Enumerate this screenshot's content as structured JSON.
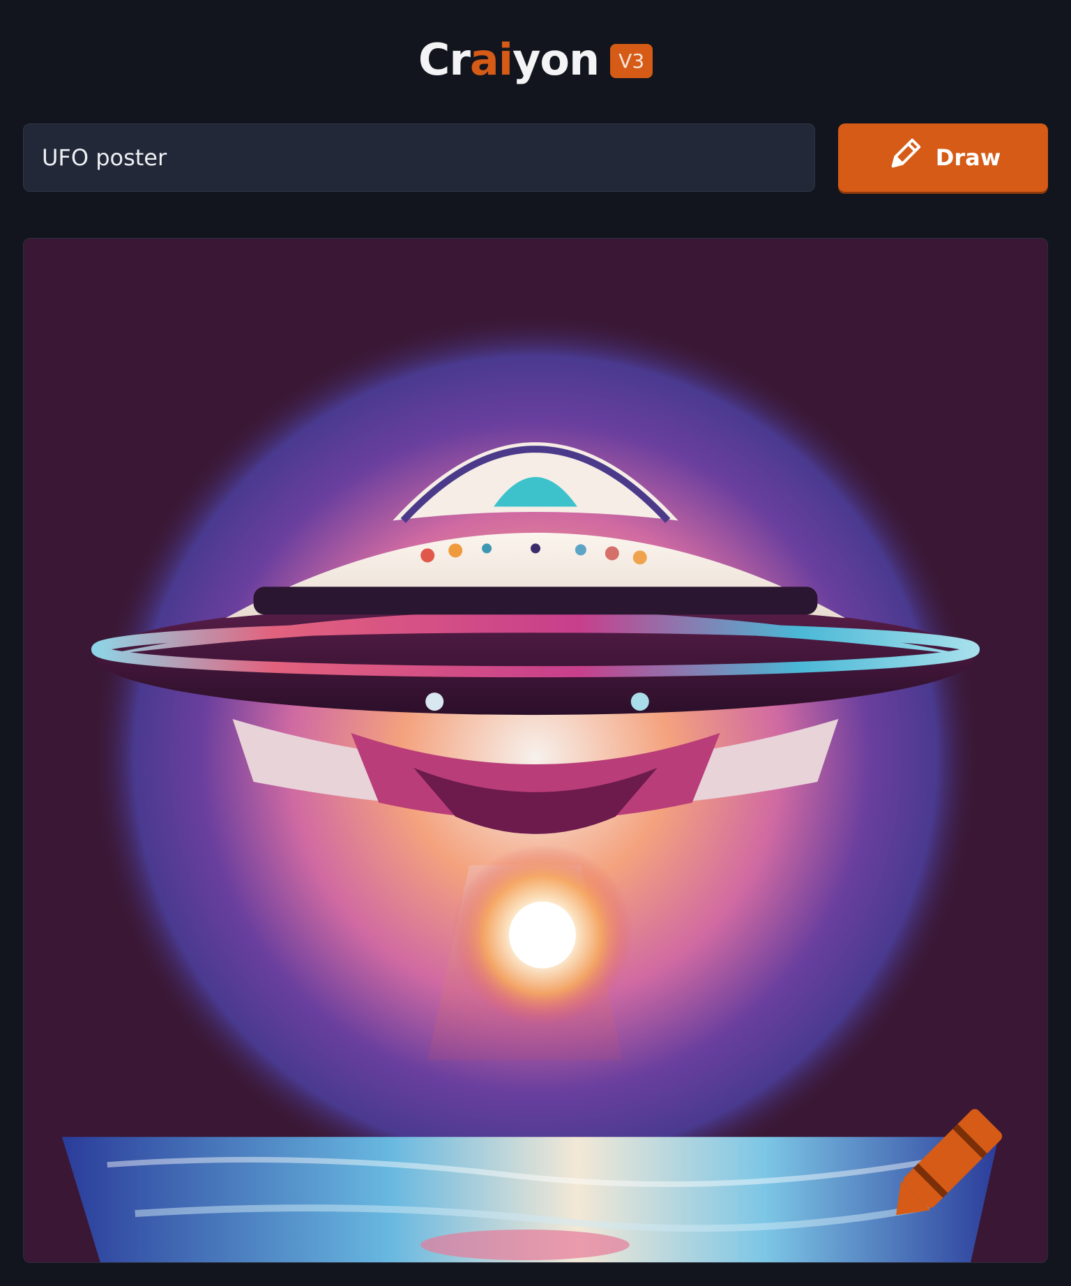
{
  "header": {
    "logo_prefix": "Cr",
    "logo_accent": "ai",
    "logo_suffix": "yon",
    "version_badge": "V3"
  },
  "prompt": {
    "value": "UFO poster"
  },
  "draw_button": {
    "label": "Draw",
    "icon": "pencil-icon"
  },
  "result": {
    "watermark_icon": "crayon-icon"
  },
  "colors": {
    "background": "#12151d",
    "input_background": "#232838",
    "accent": "#d55b16",
    "text": "#eef0f4"
  }
}
